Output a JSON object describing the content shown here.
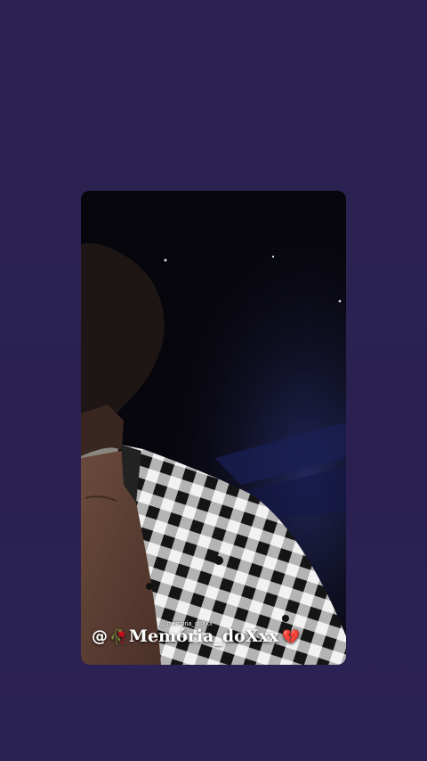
{
  "story": {
    "small_caption": "@ memória_doXxx",
    "handle_at": "@",
    "handle_rose": "🥀",
    "handle_name": "Memória_doXxx",
    "handle_heart": "💔"
  },
  "colors": {
    "background": "#2a2150",
    "card_background": "#07060c",
    "text": "#ffffff",
    "heart": "#e0243a"
  }
}
